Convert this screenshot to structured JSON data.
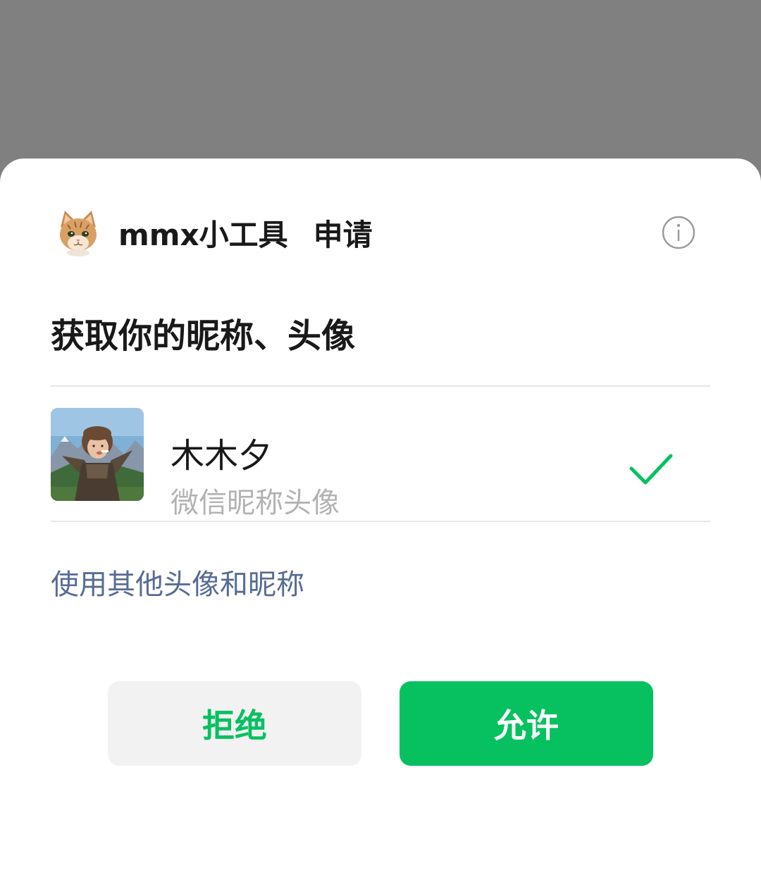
{
  "app": {
    "name": "mmx小工具",
    "request_word": "申请",
    "logo_icon": "cat-face-icon"
  },
  "info_icon": "info-icon",
  "permission": {
    "title": "获取你的昵称、头像"
  },
  "account": {
    "nickname": "木木夕",
    "subtitle": "微信昵称头像",
    "selected": true,
    "check_icon": "checkmark-icon"
  },
  "other_link": "使用其他头像和昵称",
  "buttons": {
    "reject": "拒绝",
    "allow": "允许"
  },
  "colors": {
    "accent_green": "#07c160",
    "link_blue": "#576b95",
    "overlay_gray": "#808080"
  }
}
